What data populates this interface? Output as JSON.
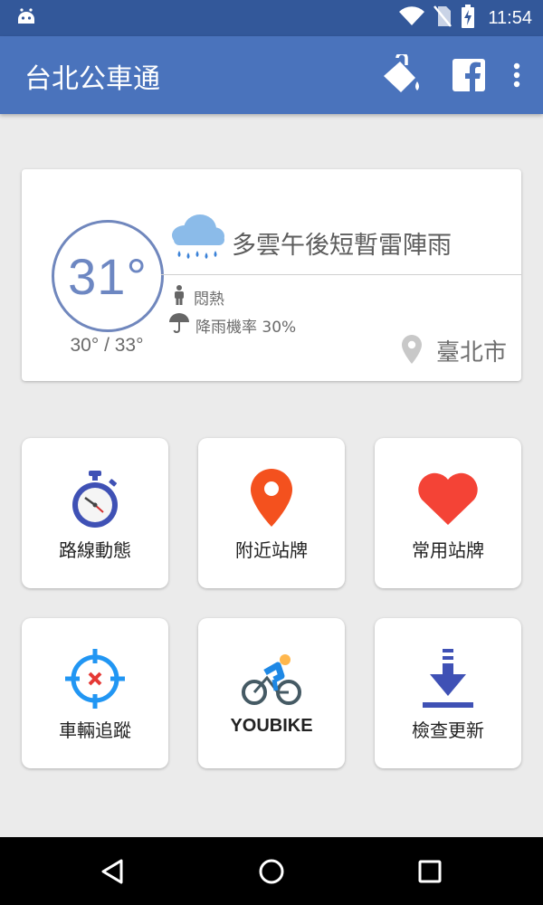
{
  "status_bar": {
    "time": "11:54",
    "icons": [
      "android-debug-icon",
      "wifi-icon",
      "no-sim-icon",
      "battery-charging-icon"
    ]
  },
  "app_bar": {
    "title": "台北公車通",
    "actions": [
      "paint-bucket-icon",
      "facebook-icon",
      "more-vert-icon"
    ]
  },
  "weather": {
    "current_temp": "31°",
    "temp_range": "30° / 33°",
    "description": "多雲午後短暫雷陣雨",
    "comfort": "悶熱",
    "rain_chance": "降雨機率 30%",
    "location": "臺北市",
    "colors": {
      "temp": "#6d87c2",
      "cloud": "#8bbbe9",
      "rain": "#3b82d8"
    }
  },
  "tiles": [
    {
      "label": "路線動態",
      "icon": "stopwatch-icon"
    },
    {
      "label": "附近站牌",
      "icon": "location-pin-icon"
    },
    {
      "label": "常用站牌",
      "icon": "heart-icon"
    },
    {
      "label": "車輛追蹤",
      "icon": "crosshair-icon"
    },
    {
      "label": "YOUBIKE",
      "icon": "cyclist-icon"
    },
    {
      "label": "檢查更新",
      "icon": "download-icon"
    }
  ],
  "nav_bar": {
    "buttons": [
      "back-icon",
      "home-icon",
      "recents-icon"
    ]
  },
  "theme": {
    "primary": "#4a73bc",
    "primary_dark": "#33589a",
    "background": "#ebebeb"
  }
}
